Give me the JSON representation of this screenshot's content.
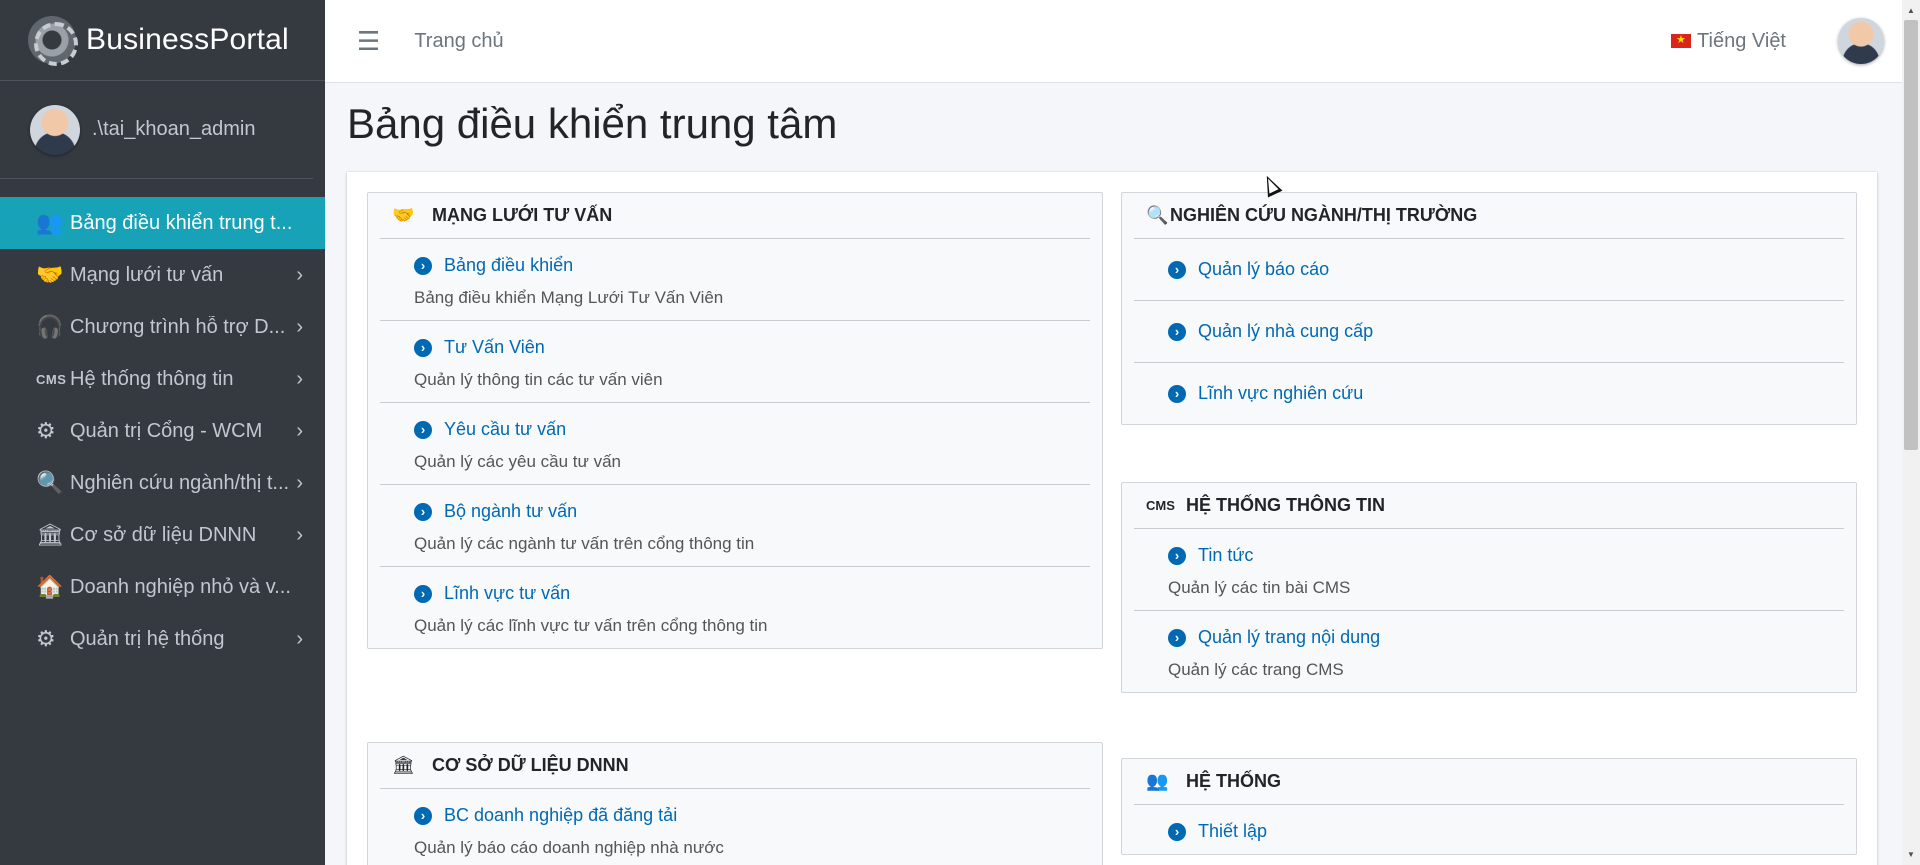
{
  "brand": {
    "name": "BusinessPortal"
  },
  "user": {
    "name": ".\\tai_khoan_admin"
  },
  "sidebar": {
    "items": [
      {
        "label": "Bảng điều khiển trung t...",
        "icon": "users-cog-icon",
        "active": true,
        "arrow": false
      },
      {
        "label": "Mạng lưới tư vấn",
        "icon": "handshake-icon",
        "arrow": true
      },
      {
        "label": "Chương trình hỗ trợ D...",
        "icon": "headset-icon",
        "arrow": true
      },
      {
        "label": "Hệ thống thông tin",
        "icon": "cms-icon",
        "icon_text": "CMS",
        "arrow": true
      },
      {
        "label": "Quản trị Cổng - WCM",
        "icon": "cogs-icon",
        "arrow": true
      },
      {
        "label": "Nghiên cứu ngành/thị t...",
        "icon": "search-dollar-icon",
        "arrow": true
      },
      {
        "label": "Cơ sở dữ liệu DNNN",
        "icon": "university-icon",
        "arrow": true
      },
      {
        "label": "Doanh nghiệp nhỏ và v...",
        "icon": "house-user-icon",
        "arrow": false
      },
      {
        "label": "Quản trị hệ thống",
        "icon": "cogs-icon",
        "arrow": true
      }
    ]
  },
  "topbar": {
    "menu_icon": "bars-icon",
    "home": "Trang chủ",
    "language": "Tiếng Việt"
  },
  "page": {
    "title": "Bảng điều khiển trung tâm"
  },
  "panels": {
    "mang_luoi": {
      "title": "MẠNG LƯỚI TƯ VẤN",
      "items": [
        {
          "label": "Bảng điều khiển",
          "desc": "Bảng điều khiển Mạng Lưới Tư Vấn Viên"
        },
        {
          "label": "Tư Vấn Viên",
          "desc": "Quản lý thông tin các tư vấn viên"
        },
        {
          "label": "Yêu cầu tư vấn",
          "desc": "Quản lý các yêu cầu tư vấn"
        },
        {
          "label": "Bộ ngành tư vấn",
          "desc": "Quản lý các ngành tư vấn trên cổng thông tin"
        },
        {
          "label": "Lĩnh vực tư vấn",
          "desc": "Quản lý các lĩnh vực tư vấn trên cổng thông tin"
        }
      ]
    },
    "co_so_du_lieu": {
      "title": "CƠ SỞ DỮ LIỆU DNNN",
      "items": [
        {
          "label": "BC doanh nghiệp đã đăng tải",
          "desc": "Quản lý báo cáo doanh nghiệp nhà nước"
        }
      ]
    },
    "nghien_cuu": {
      "title": "NGHIÊN CỨU NGÀNH/THỊ TRƯỜNG",
      "items": [
        {
          "label": "Quản lý báo cáo"
        },
        {
          "label": "Quản lý nhà cung cấp"
        },
        {
          "label": "Lĩnh vực nghiên cứu"
        }
      ]
    },
    "he_thong_thong_tin": {
      "title": "HỆ THỐNG THÔNG TIN",
      "icon_text": "CMS",
      "items": [
        {
          "label": "Tin tức",
          "desc": "Quản lý các tin bài CMS"
        },
        {
          "label": "Quản lý trang nội dung",
          "desc": "Quản lý các trang CMS"
        }
      ]
    },
    "he_thong": {
      "title": "HỆ THỐNG",
      "items": [
        {
          "label": "Thiết lập"
        }
      ]
    }
  },
  "colors": {
    "sidebar_bg": "#343a40",
    "active_bg": "#17a2b8",
    "link": "#0069b4"
  }
}
